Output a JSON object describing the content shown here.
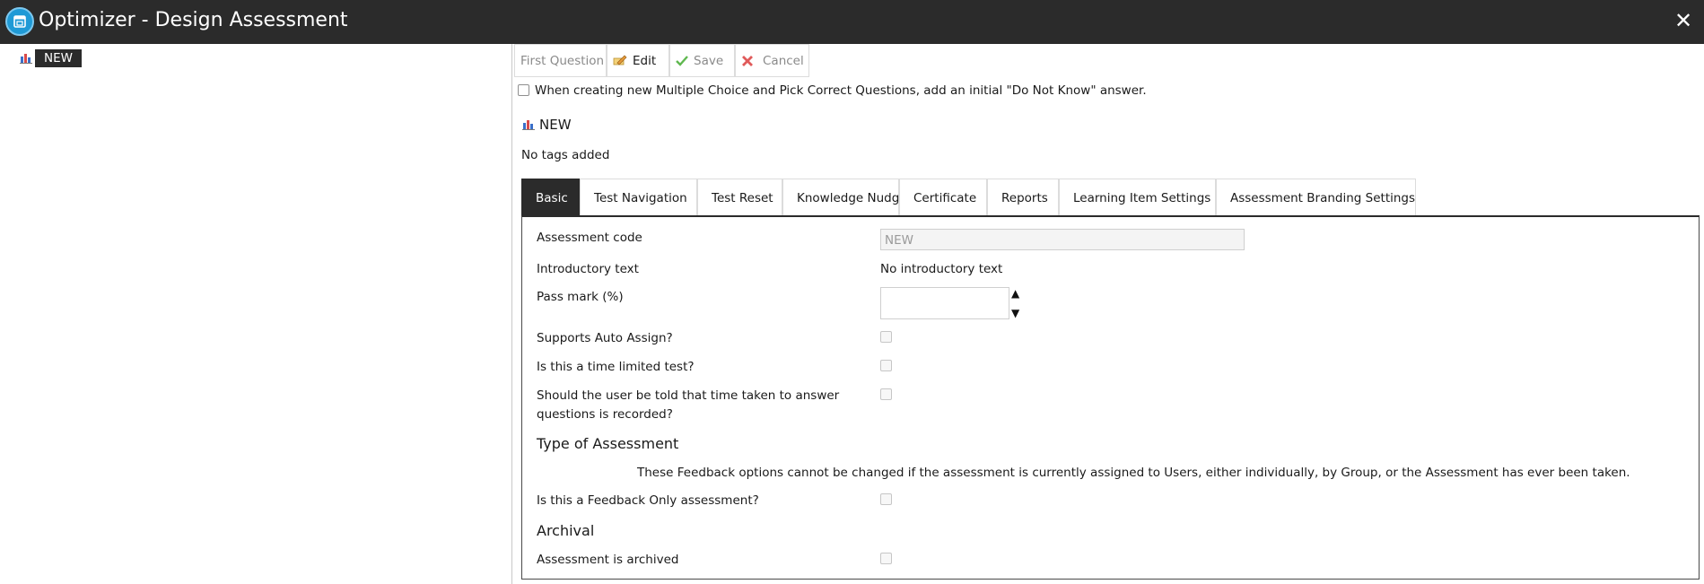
{
  "window": {
    "title": "Optimizer - Design Assessment",
    "close_glyph": "✕"
  },
  "tree": {
    "items": [
      {
        "label": "NEW",
        "icon": "bar-chart-icon"
      }
    ]
  },
  "toolbar": {
    "first_question": "First Question",
    "edit": "Edit",
    "save": "Save",
    "cancel": "Cancel"
  },
  "option_do_not_know": "When creating new Multiple Choice and Pick Correct Questions, add an initial \"Do Not Know\" answer.",
  "assessment": {
    "name": "NEW",
    "tags": "No tags added"
  },
  "tabs": [
    "Basic",
    "Test Navigation",
    "Test Reset",
    "Knowledge Nudge",
    "Certificate",
    "Reports",
    "Learning Item Settings",
    "Assessment Branding Settings"
  ],
  "basic": {
    "assessment_code_label": "Assessment code",
    "assessment_code_value": "NEW",
    "intro_label": "Introductory text",
    "intro_value": "No introductory text",
    "pass_mark_label": "Pass mark (%)",
    "spin_up": "▲",
    "spin_down": "▼",
    "auto_assign_label": "Supports Auto Assign?",
    "time_limited_label": "Is this a time limited test?",
    "time_recorded_line1": "Should the user be told that time taken to answer",
    "time_recorded_line2": "questions is recorded?",
    "type_heading": "Type of Assessment",
    "feedback_note": "These Feedback options cannot be changed if the assessment is currently assigned to Users, either individually, by Group, or the Assessment has ever been taken.",
    "feedback_only_label": "Is this a Feedback Only assessment?",
    "archival_heading": "Archival",
    "archived_label": "Assessment is archived"
  },
  "colors": {
    "titlebar": "#2b2b2b",
    "accent": "#1f9ad6",
    "save_check": "#5fb84f",
    "cancel_x": "#e05a5a"
  }
}
